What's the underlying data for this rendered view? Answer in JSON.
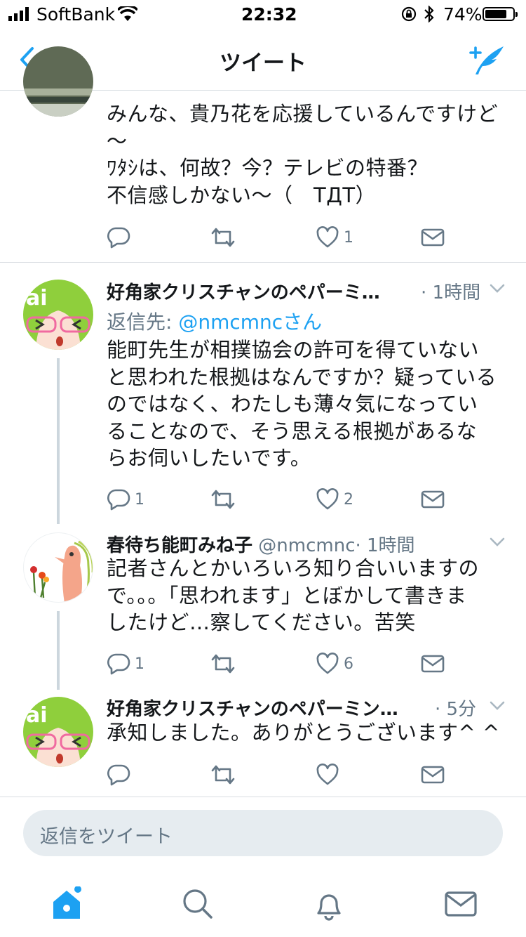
{
  "status_bar": {
    "carrier": "SoftBank",
    "time": "22:32",
    "battery": "74%"
  },
  "nav": {
    "title": "ツイート",
    "back_icon": "chevron-left-icon",
    "compose_icon": "compose-tweet-icon"
  },
  "colors": {
    "accent": "#1da1f2",
    "text": "#14171a",
    "muted": "#657786",
    "divider": "#d8dde2",
    "thread_line": "#ccd6dd"
  },
  "tweets": [
    {
      "body": [
        "みんな、貴乃花を応援しているんですけど",
        "〜",
        "ﾜﾀｼは、何故？今？テレビの特番？",
        "不信感しかない〜（　ТДТ）"
      ],
      "reply_count": "",
      "retweet_count": "",
      "like_count": "1"
    },
    {
      "name": "好角家クリスチャンのペパーミ…",
      "time": "· 1時間",
      "reply_to_label": "返信先:",
      "reply_to_user": "@nmcmncさん",
      "body": [
        "能町先生が相撲協会の許可を得ていない",
        "と思われた根拠はなんですか？疑っている",
        "のではなく、わたしも薄々気になってい",
        "ることなので、そう思える根拠があるな",
        "らお伺いしたいです。"
      ],
      "reply_count": "1",
      "retweet_count": "",
      "like_count": "2"
    },
    {
      "name": "春待ち能町みね子",
      "handle": "@nmcmnc",
      "time": "· 1時間",
      "body": [
        "記者さんとかいろいろ知り合いいますの",
        "で。。。「思われます」とぼかして書きま",
        "したけど…察してください。苦笑"
      ],
      "reply_count": "1",
      "retweet_count": "",
      "like_count": "6"
    },
    {
      "name": "好角家クリスチャンのペパーミン…",
      "time": "· 5分",
      "body": [
        "承知しました。ありがとうございます^ ^"
      ],
      "reply_count": "",
      "retweet_count": "",
      "like_count": ""
    }
  ],
  "reply_input": {
    "placeholder": "返信をツイート"
  },
  "tab_bar": {
    "items": [
      "home-icon",
      "search-icon",
      "notifications-icon",
      "messages-icon"
    ]
  }
}
